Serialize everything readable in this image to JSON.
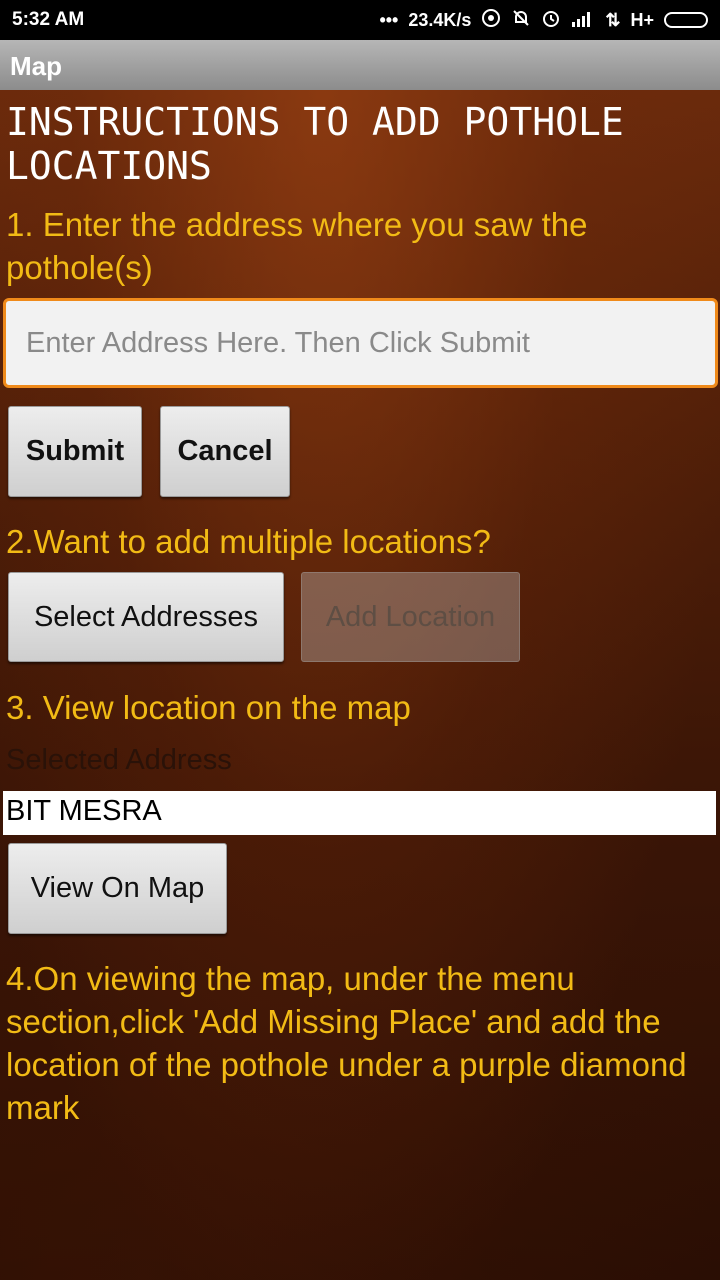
{
  "status_bar": {
    "time": "5:32 AM",
    "speed": "23.4K/s",
    "network": "H+",
    "icons": [
      "dots-icon",
      "hotspot-icon",
      "mute-bell-icon",
      "alarm-icon",
      "signal-icon",
      "data-arrows-icon",
      "battery-icon"
    ]
  },
  "title_bar": {
    "title": "Map"
  },
  "content": {
    "heading": "INSTRUCTIONS TO ADD POTHOLE LOCATIONS",
    "step1": "1. Enter the address where you saw the pothole(s)",
    "address_input": {
      "placeholder": "Enter Address Here. Then Click Submit",
      "value": ""
    },
    "submit_label": "Submit",
    "cancel_label": "Cancel",
    "step2": "2.Want to add multiple locations?",
    "select_addresses_label": "Select Addresses",
    "add_location_label": "Add Location",
    "step3": "3. View location on the map",
    "selected_address_label": "Selected Address",
    "selected_address_value": "BIT MESRA",
    "view_on_map_label": "View On Map",
    "step4": "4.On viewing the map, under the menu section,click 'Add Missing Place' and add the location of the pothole under a purple diamond mark"
  },
  "colors": {
    "accent_text": "#f2bb15",
    "input_border": "#f08a1a",
    "title_bar": "#a0a0a0"
  }
}
